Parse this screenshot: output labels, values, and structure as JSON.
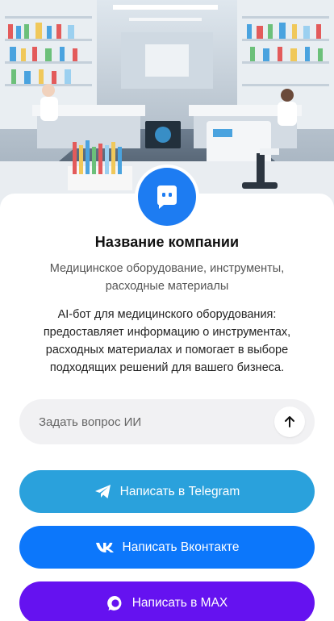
{
  "company": {
    "name": "Название компании",
    "subtitle": "Медицинское оборудование, инструменты, расходные материалы",
    "description": "AI-бот для медицинского оборудования: предоставляет информацию о инструментах, расходных материалах и помогает в выборе подходящих решений для вашего бизнеса."
  },
  "hero": {
    "image": "laboratory-illustration"
  },
  "ask": {
    "placeholder": "Задать вопрос ИИ",
    "send_icon": "arrow-up-icon"
  },
  "buttons": {
    "telegram": {
      "label": "Написать в Telegram",
      "icon": "telegram-icon",
      "color": "#2aa1dc"
    },
    "vk": {
      "label": "Написать Вконтакте",
      "icon": "vk-icon",
      "color": "#0c77fb"
    },
    "max": {
      "label": "Написать в MAX",
      "icon": "max-icon",
      "color": "#6512f0"
    }
  },
  "colors": {
    "accent": "#1d7cf2"
  }
}
